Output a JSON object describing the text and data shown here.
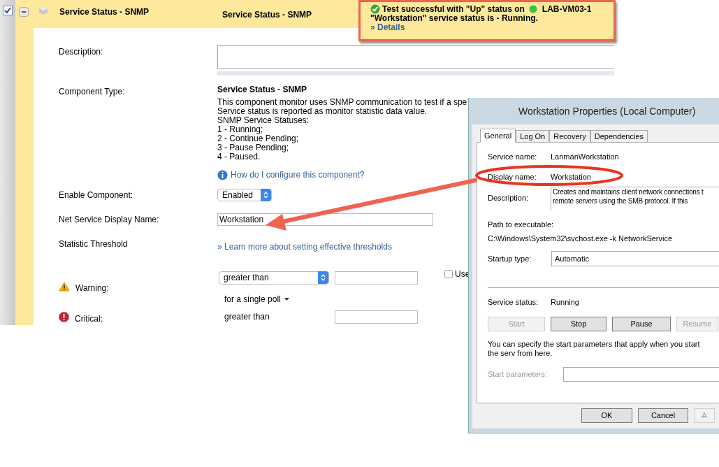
{
  "row_header": {
    "checked": true,
    "expanded": true,
    "name": "Service Status - SNMP",
    "type": "Service Status - SNMP"
  },
  "callout": {
    "line_1": "Test successful with \"Up\" status on",
    "node": "LAB-VM03-1",
    "line_2": "\"Workstation\" service status is - Running.",
    "link": "» Details"
  },
  "form": {
    "description": {
      "label": "Description:"
    },
    "component_type": {
      "label": "Component Type:",
      "title": "Service Status - SNMP",
      "lines": [
        "This component monitor uses SNMP communication to test if a spe",
        "Service status is reported as monitor statistic data value.",
        "SNMP Service Statuses:",
        "1 - Running;",
        "2 - Continue Pending;",
        "3 - Pause Pending;",
        "4 - Paused."
      ],
      "help_link": "How do I configure this component?"
    },
    "enable": {
      "label": "Enable Component:",
      "value": "Enabled"
    },
    "net_service": {
      "label": "Net Service Display Name:",
      "value": "Workstation"
    },
    "threshold": {
      "label": "Statistic Threshold",
      "link": "» Learn more about setting effective thresholds"
    },
    "warning": {
      "label": "Warning:",
      "operator": "greater than",
      "use": {
        "label": "Use",
        "checked": false
      },
      "poll": "for a single poll"
    },
    "critical": {
      "label": "Critical:",
      "operator": "greater than"
    }
  },
  "dialog": {
    "title": "Workstation Properties (Local Computer)",
    "tabs": [
      {
        "label": "General",
        "selected": true
      },
      {
        "label": "Log On",
        "selected": false
      },
      {
        "label": "Recovery",
        "selected": false
      },
      {
        "label": "Dependencies",
        "selected": false
      }
    ],
    "service_name": {
      "label": "Service name:",
      "value": "LanmanWorkstation"
    },
    "display_name": {
      "label": "Display name:",
      "value": "Workstation"
    },
    "description": {
      "label": "Description:",
      "lines": [
        "Creates and maintains client network connections t",
        "remote servers using the SMB protocol. If this"
      ]
    },
    "path": {
      "label": "Path to executable:",
      "value": "C:\\Windows\\System32\\svchost.exe -k NetworkService"
    },
    "startup": {
      "label": "Startup type:",
      "value": "Automatic"
    },
    "status": {
      "label": "Service status:",
      "value": "Running"
    },
    "service_buttons": [
      {
        "label": "Start",
        "disabled": true
      },
      {
        "label": "Stop",
        "disabled": false
      },
      {
        "label": "Pause",
        "disabled": false
      },
      {
        "label": "Resume",
        "disabled": true
      }
    ],
    "note": "You can specify the start parameters that apply when you start the serv from here.",
    "start_parameters": {
      "label": "Start parameters:",
      "disabled": true
    },
    "buttons": [
      {
        "label": "OK",
        "disabled": false
      },
      {
        "label": "Cancel",
        "disabled": false
      },
      {
        "label": "A",
        "disabled": true
      }
    ]
  }
}
